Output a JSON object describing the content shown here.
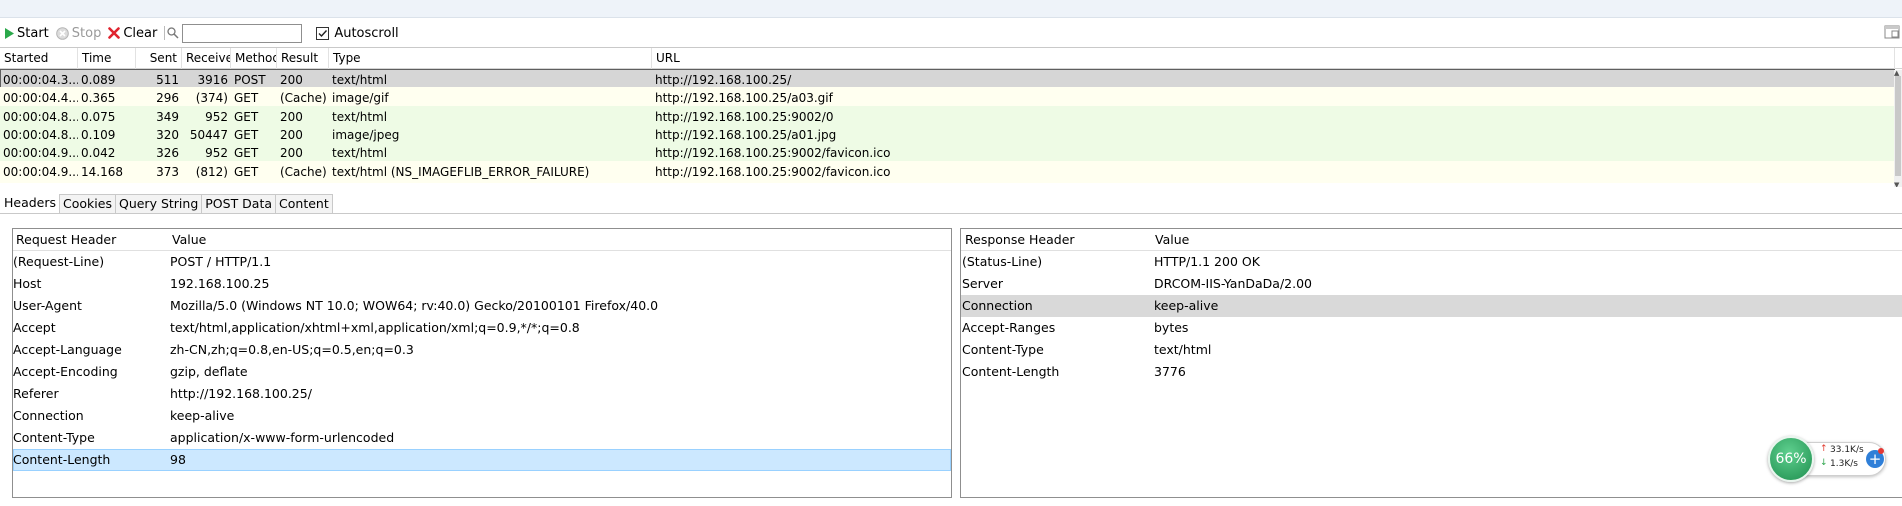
{
  "toolbar": {
    "start_label": "Start",
    "stop_label": "Stop",
    "clear_label": "Clear",
    "search_value": "",
    "autoscroll_label": "Autoscroll",
    "autoscroll_checked": true
  },
  "grid": {
    "columns": [
      "Started",
      "Time",
      "Sent",
      "Received",
      "Method",
      "Result",
      "Type",
      "URL"
    ],
    "rows": [
      {
        "started": "00:00:04.3...",
        "time": "0.089",
        "sent": "511",
        "received": "3916",
        "method": "POST",
        "result": "200",
        "type": "text/html",
        "url": "http://192.168.100.25/",
        "state": "selected"
      },
      {
        "started": "00:00:04.4...",
        "time": "0.365",
        "sent": "296",
        "received": "(374)",
        "method": "GET",
        "result": "(Cache)",
        "type": "image/gif",
        "url": "http://192.168.100.25/a03.gif",
        "state": "cached"
      },
      {
        "started": "00:00:04.8...",
        "time": "0.075",
        "sent": "349",
        "received": "952",
        "method": "GET",
        "result": "200",
        "type": "text/html",
        "url": "http://192.168.100.25:9002/0",
        "state": "fresh"
      },
      {
        "started": "00:00:04.8...",
        "time": "0.109",
        "sent": "320",
        "received": "50447",
        "method": "GET",
        "result": "200",
        "type": "image/jpeg",
        "url": "http://192.168.100.25/a01.jpg",
        "state": "fresh"
      },
      {
        "started": "00:00:04.9...",
        "time": "0.042",
        "sent": "326",
        "received": "952",
        "method": "GET",
        "result": "200",
        "type": "text/html",
        "url": "http://192.168.100.25:9002/favicon.ico",
        "state": "fresh"
      },
      {
        "started": "00:00:04.9...",
        "time": "14.168",
        "sent": "373",
        "received": "(812)",
        "method": "GET",
        "result": "(Cache)",
        "type": "text/html (NS_IMAGEFLIB_ERROR_FAILURE)",
        "url": "http://192.168.100.25:9002/favicon.ico",
        "state": "cached"
      }
    ]
  },
  "tabs": [
    "Headers",
    "Cookies",
    "Query String",
    "POST Data",
    "Content"
  ],
  "request": {
    "header_col": "Request Header",
    "value_col": "Value",
    "rows": [
      {
        "name": "(Request-Line)",
        "value": "POST / HTTP/1.1"
      },
      {
        "name": "Host",
        "value": "192.168.100.25"
      },
      {
        "name": "User-Agent",
        "value": "Mozilla/5.0 (Windows NT 10.0; WOW64; rv:40.0) Gecko/20100101 Firefox/40.0"
      },
      {
        "name": "Accept",
        "value": "text/html,application/xhtml+xml,application/xml;q=0.9,*/*;q=0.8"
      },
      {
        "name": "Accept-Language",
        "value": "zh-CN,zh;q=0.8,en-US;q=0.5,en;q=0.3"
      },
      {
        "name": "Accept-Encoding",
        "value": "gzip, deflate"
      },
      {
        "name": "Referer",
        "value": "http://192.168.100.25/"
      },
      {
        "name": "Connection",
        "value": "keep-alive"
      },
      {
        "name": "Content-Type",
        "value": "application/x-www-form-urlencoded"
      },
      {
        "name": "Content-Length",
        "value": "98"
      }
    ]
  },
  "response": {
    "header_col": "Response Header",
    "value_col": "Value",
    "rows": [
      {
        "name": "(Status-Line)",
        "value": "HTTP/1.1 200 OK"
      },
      {
        "name": "Server",
        "value": "DRCOM-IIS-YanDaDa/2.00"
      },
      {
        "name": "Connection",
        "value": "keep-alive"
      },
      {
        "name": "Accept-Ranges",
        "value": "bytes"
      },
      {
        "name": "Content-Type",
        "value": "text/html"
      },
      {
        "name": "Content-Length",
        "value": "3776"
      }
    ]
  },
  "net_widget": {
    "percent": "66%",
    "up_speed": "33.1K/s",
    "down_speed": "1.3K/s"
  }
}
